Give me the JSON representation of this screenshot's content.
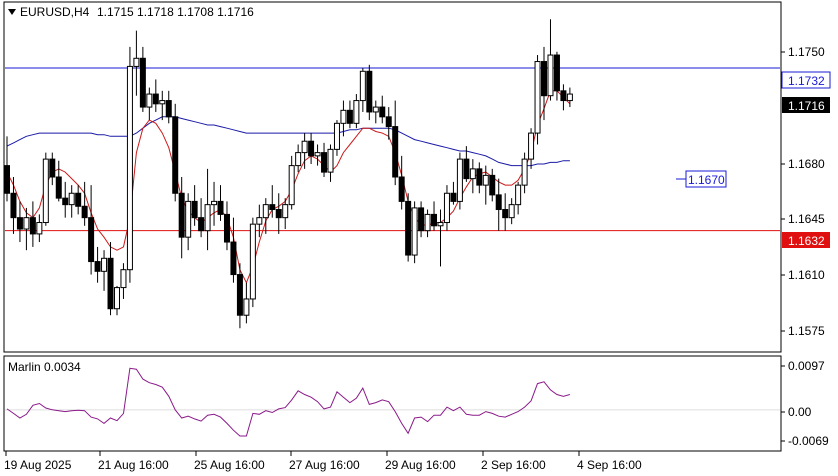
{
  "header": {
    "symbol": "EURUSD,H4",
    "ohlc": "1.1715 1.1718 1.1708 1.1716",
    "arrow_icon": "triangle-down-icon"
  },
  "indicator": {
    "label": "Marlin 0.0034"
  },
  "price_axis": {
    "ticks": [
      "1.1750",
      "1.1680",
      "1.1645",
      "1.1610",
      "1.1575"
    ]
  },
  "indicator_axis": {
    "ticks": [
      "0.0097",
      "0.00",
      "-0.0069"
    ]
  },
  "time_axis": {
    "ticks": [
      "19 Aug 2025",
      "21 Aug 16:00",
      "25 Aug 16:00",
      "27 Aug 16:00",
      "29 Aug 16:00",
      "2 Sep 16:00",
      "4 Sep 16:00"
    ]
  },
  "price_labels": {
    "blue_level": "1.1732",
    "current": "1.1716",
    "red_level": "1.1632",
    "target": "1.1670"
  },
  "colors": {
    "blue_line": "#1a1ad6",
    "red_line": "#e01010",
    "ma_red": "#cc1a1a",
    "ma_blue": "#1a1aa6",
    "marlin": "#8a1a8a",
    "current_bg": "#000000"
  },
  "chart_data": {
    "type": "candlestick",
    "y_range": [
      1.1558,
      1.1772
    ],
    "horizontal_levels": [
      1.1732,
      1.1632
    ],
    "target_level": 1.167,
    "candles": [
      [
        1.1672,
        1.169,
        1.165,
        1.1655
      ],
      [
        1.1655,
        1.1665,
        1.163,
        1.164
      ],
      [
        1.164,
        1.165,
        1.1625,
        1.1633
      ],
      [
        1.1633,
        1.1646,
        1.162,
        1.164
      ],
      [
        1.164,
        1.165,
        1.1622,
        1.163
      ],
      [
        1.163,
        1.1642,
        1.1625,
        1.1637
      ],
      [
        1.1637,
        1.168,
        1.1635,
        1.1676
      ],
      [
        1.1676,
        1.168,
        1.166,
        1.1665
      ],
      [
        1.1665,
        1.1675,
        1.165,
        1.1652
      ],
      [
        1.1652,
        1.1662,
        1.164,
        1.1648
      ],
      [
        1.1648,
        1.166,
        1.164,
        1.1655
      ],
      [
        1.1655,
        1.166,
        1.1642,
        1.1647
      ],
      [
        1.1647,
        1.1662,
        1.1635,
        1.164
      ],
      [
        1.164,
        1.166,
        1.1605,
        1.1613
      ],
      [
        1.1613,
        1.1622,
        1.16,
        1.1607
      ],
      [
        1.1607,
        1.162,
        1.1595,
        1.1615
      ],
      [
        1.1615,
        1.1625,
        1.158,
        1.1584
      ],
      [
        1.1584,
        1.1598,
        1.158,
        1.1597
      ],
      [
        1.1597,
        1.1612,
        1.159,
        1.1608
      ],
      [
        1.1608,
        1.1745,
        1.16,
        1.1733
      ],
      [
        1.1733,
        1.1755,
        1.1715,
        1.1738
      ],
      [
        1.1738,
        1.1745,
        1.1705,
        1.1708
      ],
      [
        1.1708,
        1.172,
        1.17,
        1.1716
      ],
      [
        1.1716,
        1.1725,
        1.1705,
        1.171
      ],
      [
        1.171,
        1.1718,
        1.17,
        1.1712
      ],
      [
        1.1712,
        1.1718,
        1.1698,
        1.1702
      ],
      [
        1.1702,
        1.171,
        1.165,
        1.1655
      ],
      [
        1.1655,
        1.1665,
        1.1615,
        1.1628
      ],
      [
        1.1628,
        1.1655,
        1.162,
        1.165
      ],
      [
        1.165,
        1.166,
        1.1635,
        1.164
      ],
      [
        1.164,
        1.1652,
        1.1628,
        1.1632
      ],
      [
        1.1632,
        1.167,
        1.162,
        1.1648
      ],
      [
        1.1648,
        1.1662,
        1.1635,
        1.165
      ],
      [
        1.165,
        1.166,
        1.1638,
        1.1642
      ],
      [
        1.1642,
        1.165,
        1.162,
        1.1625
      ],
      [
        1.1625,
        1.164,
        1.16,
        1.1605
      ],
      [
        1.1605,
        1.1612,
        1.1572,
        1.158
      ],
      [
        1.158,
        1.16,
        1.1575,
        1.159
      ],
      [
        1.159,
        1.164,
        1.1585,
        1.1636
      ],
      [
        1.1636,
        1.1648,
        1.1628,
        1.164
      ],
      [
        1.164,
        1.1652,
        1.163,
        1.1648
      ],
      [
        1.1648,
        1.166,
        1.164,
        1.1645
      ],
      [
        1.1645,
        1.1655,
        1.163,
        1.164
      ],
      [
        1.164,
        1.1652,
        1.1633,
        1.1648
      ],
      [
        1.1648,
        1.1678,
        1.1645,
        1.1672
      ],
      [
        1.1672,
        1.1685,
        1.1668,
        1.168
      ],
      [
        1.168,
        1.1692,
        1.167,
        1.1687
      ],
      [
        1.1687,
        1.1692,
        1.1673,
        1.1678
      ],
      [
        1.1678,
        1.1685,
        1.1672,
        1.168
      ],
      [
        1.168,
        1.1686,
        1.1665,
        1.1668
      ],
      [
        1.1668,
        1.1685,
        1.1662,
        1.1682
      ],
      [
        1.1682,
        1.17,
        1.1678,
        1.1698
      ],
      [
        1.1698,
        1.1712,
        1.169,
        1.1706
      ],
      [
        1.1706,
        1.1712,
        1.1695,
        1.1698
      ],
      [
        1.1698,
        1.1716,
        1.1695,
        1.1712
      ],
      [
        1.1712,
        1.1732,
        1.1705,
        1.173
      ],
      [
        1.173,
        1.1734,
        1.17,
        1.1705
      ],
      [
        1.1705,
        1.1712,
        1.1698,
        1.1708
      ],
      [
        1.1708,
        1.1715,
        1.1698,
        1.1702
      ],
      [
        1.1702,
        1.1708,
        1.1688,
        1.1696
      ],
      [
        1.1696,
        1.1712,
        1.166,
        1.1665
      ],
      [
        1.1665,
        1.1678,
        1.1645,
        1.165
      ],
      [
        1.165,
        1.1655,
        1.1613,
        1.1617
      ],
      [
        1.1617,
        1.165,
        1.1612,
        1.1646
      ],
      [
        1.1646,
        1.165,
        1.1628,
        1.1632
      ],
      [
        1.1632,
        1.1645,
        1.1628,
        1.1642
      ],
      [
        1.1642,
        1.165,
        1.1632,
        1.1635
      ],
      [
        1.1635,
        1.1645,
        1.161,
        1.1637
      ],
      [
        1.1637,
        1.166,
        1.1632,
        1.1655
      ],
      [
        1.1655,
        1.1662,
        1.1648,
        1.165
      ],
      [
        1.165,
        1.168,
        1.1645,
        1.1676
      ],
      [
        1.1676,
        1.1684,
        1.1662,
        1.1664
      ],
      [
        1.1664,
        1.1676,
        1.1655,
        1.167
      ],
      [
        1.167,
        1.1674,
        1.1655,
        1.166
      ],
      [
        1.166,
        1.1672,
        1.1648,
        1.1666
      ],
      [
        1.1666,
        1.167,
        1.165,
        1.1654
      ],
      [
        1.1654,
        1.1664,
        1.1632,
        1.1645
      ],
      [
        1.1645,
        1.1655,
        1.1632,
        1.164
      ],
      [
        1.164,
        1.1652,
        1.1636,
        1.1648
      ],
      [
        1.1648,
        1.1662,
        1.1642,
        1.166
      ],
      [
        1.166,
        1.168,
        1.1655,
        1.1676
      ],
      [
        1.1676,
        1.1695,
        1.167,
        1.1692
      ],
      [
        1.1692,
        1.174,
        1.1685,
        1.1736
      ],
      [
        1.1736,
        1.1745,
        1.17,
        1.1715
      ],
      [
        1.1715,
        1.1762,
        1.1712,
        1.174
      ],
      [
        1.174,
        1.1742,
        1.1712,
        1.1718
      ],
      [
        1.1718,
        1.1722,
        1.1706,
        1.1712
      ],
      [
        1.1712,
        1.172,
        1.1708,
        1.1716
      ]
    ],
    "ma_red": [
      1.1668,
      1.166,
      1.165,
      1.1643,
      1.164,
      1.1646,
      1.166,
      1.1668,
      1.167,
      1.1668,
      1.1664,
      1.166,
      1.1655,
      1.1643,
      1.1633,
      1.1628,
      1.1622,
      1.162,
      1.1622,
      1.164,
      1.168,
      1.1695,
      1.17,
      1.1698,
      1.1692,
      1.1683,
      1.1668,
      1.1652,
      1.1644,
      1.164,
      1.1637,
      1.164,
      1.1643,
      1.1645,
      1.164,
      1.1628,
      1.1608,
      1.16,
      1.161,
      1.1625,
      1.1638,
      1.1645,
      1.1647,
      1.165,
      1.1657,
      1.1667,
      1.1675,
      1.1678,
      1.1676,
      1.1672,
      1.1668,
      1.1672,
      1.168,
      1.1685,
      1.169,
      1.1695,
      1.1695,
      1.1693,
      1.1692,
      1.169,
      1.168,
      1.1666,
      1.165,
      1.164,
      1.1636,
      1.1635,
      1.1637,
      1.1637,
      1.164,
      1.1644,
      1.1652,
      1.1659,
      1.1665,
      1.1667,
      1.1668,
      1.1665,
      1.1662,
      1.166,
      1.166,
      1.1663,
      1.167,
      1.168,
      1.1697,
      1.1707,
      1.1718,
      1.1718,
      1.1714,
      1.171
    ],
    "ma_blue": [
      1.1684,
      1.1686,
      1.1688,
      1.169,
      1.1691,
      1.1692,
      1.1692,
      1.1692,
      1.1692,
      1.1692,
      1.1692,
      1.1692,
      1.1692,
      1.1692,
      1.1691,
      1.1691,
      1.169,
      1.169,
      1.169,
      1.169,
      1.1692,
      1.1695,
      1.1698,
      1.17,
      1.1702,
      1.1702,
      1.1702,
      1.1701,
      1.17,
      1.1699,
      1.1698,
      1.1697,
      1.1697,
      1.1696,
      1.1695,
      1.1694,
      1.1693,
      1.1692,
      1.1692,
      1.1692,
      1.1692,
      1.1692,
      1.1692,
      1.1692,
      1.1692,
      1.1692,
      1.1692,
      1.1692,
      1.1692,
      1.1692,
      1.1692,
      1.1692,
      1.1693,
      1.1694,
      1.1694,
      1.1695,
      1.1695,
      1.1695,
      1.1695,
      1.1695,
      1.1694,
      1.1692,
      1.169,
      1.1688,
      1.1687,
      1.1686,
      1.1685,
      1.1684,
      1.1683,
      1.1682,
      1.1681,
      1.1681,
      1.168,
      1.1679,
      1.1678,
      1.1676,
      1.1674,
      1.1673,
      1.1672,
      1.1672,
      1.1672,
      1.1672,
      1.1673,
      1.1673,
      1.1674,
      1.1674,
      1.1675,
      1.1675
    ],
    "marlin_range": [
      -0.0069,
      0.0097
    ],
    "marlin": [
      0.0002,
      -0.0008,
      -0.0018,
      -0.001,
      0.001,
      0.0014,
      0.0004,
      0.0,
      -0.0002,
      -0.0004,
      -0.0002,
      -0.0001,
      -0.0002,
      -0.0016,
      -0.002,
      -0.003,
      -0.0018,
      -0.0024,
      -0.0008,
      0.0092,
      0.009,
      0.0068,
      0.006,
      0.0056,
      0.005,
      0.003,
      0.0,
      -0.0018,
      -0.0014,
      -0.002,
      -0.0025,
      -0.0012,
      -0.001,
      -0.0016,
      -0.003,
      -0.0045,
      -0.0058,
      -0.0058,
      -0.0008,
      -0.001,
      -0.0002,
      -0.0006,
      0.0002,
      0.0005,
      0.0022,
      0.0042,
      0.0034,
      0.0028,
      0.0018,
      0.0002,
      0.0006,
      0.004,
      0.0028,
      0.0016,
      0.0026,
      0.0048,
      0.0012,
      0.0016,
      0.0022,
      0.0018,
      -0.0004,
      -0.003,
      -0.0052,
      -0.0018,
      -0.0016,
      -0.0026,
      -0.0012,
      -0.0012,
      0.0006,
      -0.0002,
      0.0006,
      -0.001,
      -0.0012,
      -0.0012,
      -0.0004,
      -0.0008,
      -0.0014,
      -0.0016,
      -0.001,
      -0.0004,
      0.0006,
      0.002,
      0.0058,
      0.0062,
      0.0044,
      0.0034,
      0.003,
      0.0034
    ]
  }
}
